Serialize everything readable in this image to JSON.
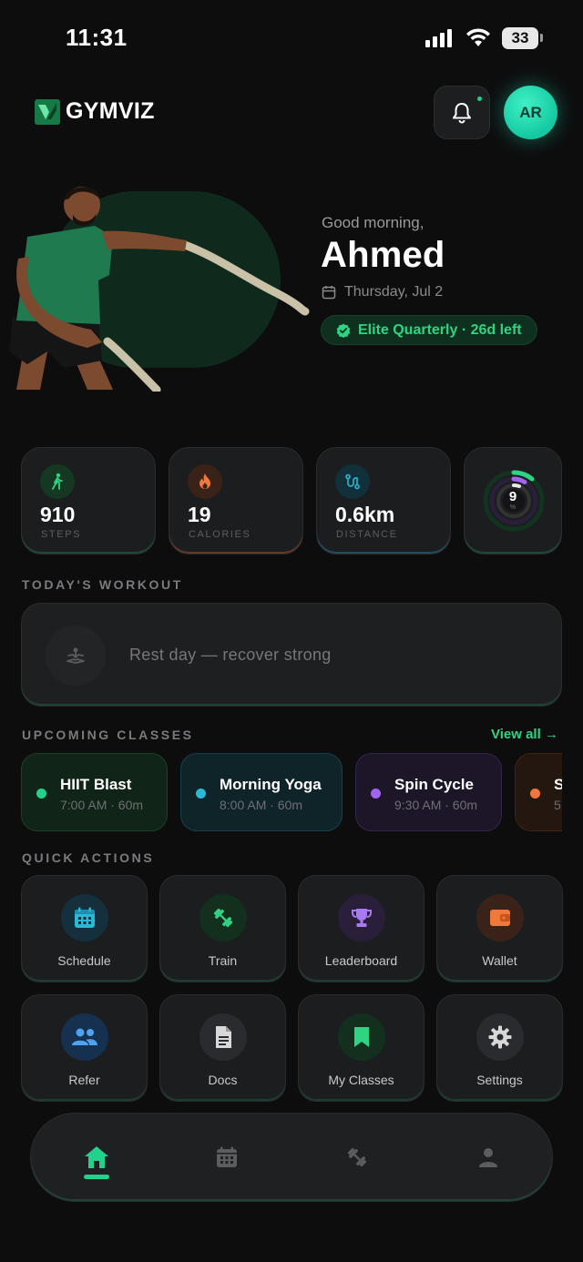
{
  "status_bar": {
    "time": "11:31",
    "battery": "33"
  },
  "header": {
    "brand": "GYMVIZ",
    "avatar_initials": "AR"
  },
  "hero": {
    "greeting": "Good morning,",
    "name": "Ahmed",
    "date": "Thursday, Jul 2",
    "membership": "Elite Quarterly · 26d left"
  },
  "stats": [
    {
      "value": "910",
      "label": "STEPS",
      "icon": "walk-icon",
      "color": "#2fd483"
    },
    {
      "value": "19",
      "label": "CALORIES",
      "icon": "flame-icon",
      "color": "#f0783a"
    },
    {
      "value": "0.6km",
      "label": "DISTANCE",
      "icon": "route-icon",
      "color": "#2bb8d6"
    }
  ],
  "activity_ring": {
    "value": "9",
    "unit": "%"
  },
  "workout": {
    "section_title": "TODAY'S WORKOUT",
    "text": "Rest day — recover strong"
  },
  "classes": {
    "section_title": "UPCOMING CLASSES",
    "view_all": "View all →",
    "items": [
      {
        "name": "HIIT Blast",
        "time": "7:00 AM · 60m",
        "color": "#22d18b"
      },
      {
        "name": "Morning Yoga",
        "time": "8:00 AM · 60m",
        "color": "#2bb8d6"
      },
      {
        "name": "Spin Cycle",
        "time": "9:30 AM · 60m",
        "color": "#a064f0"
      },
      {
        "name": "S",
        "time": "5",
        "color": "#f0783a"
      }
    ]
  },
  "quick_actions": {
    "section_title": "QUICK ACTIONS",
    "items": [
      {
        "label": "Schedule",
        "icon": "calendar-icon"
      },
      {
        "label": "Train",
        "icon": "dumbbell-icon"
      },
      {
        "label": "Leaderboard",
        "icon": "trophy-icon"
      },
      {
        "label": "Wallet",
        "icon": "wallet-icon"
      },
      {
        "label": "Refer",
        "icon": "people-icon"
      },
      {
        "label": "Docs",
        "icon": "document-icon"
      },
      {
        "label": "My Classes",
        "icon": "bookmark-icon"
      },
      {
        "label": "Settings",
        "icon": "gear-icon"
      }
    ]
  },
  "nav": {
    "items": [
      "home-icon",
      "calendar-icon",
      "dumbbell-icon",
      "profile-icon"
    ],
    "active": "home"
  },
  "colors": {
    "accent": "#22d18b",
    "background": "#0d0d0e"
  }
}
